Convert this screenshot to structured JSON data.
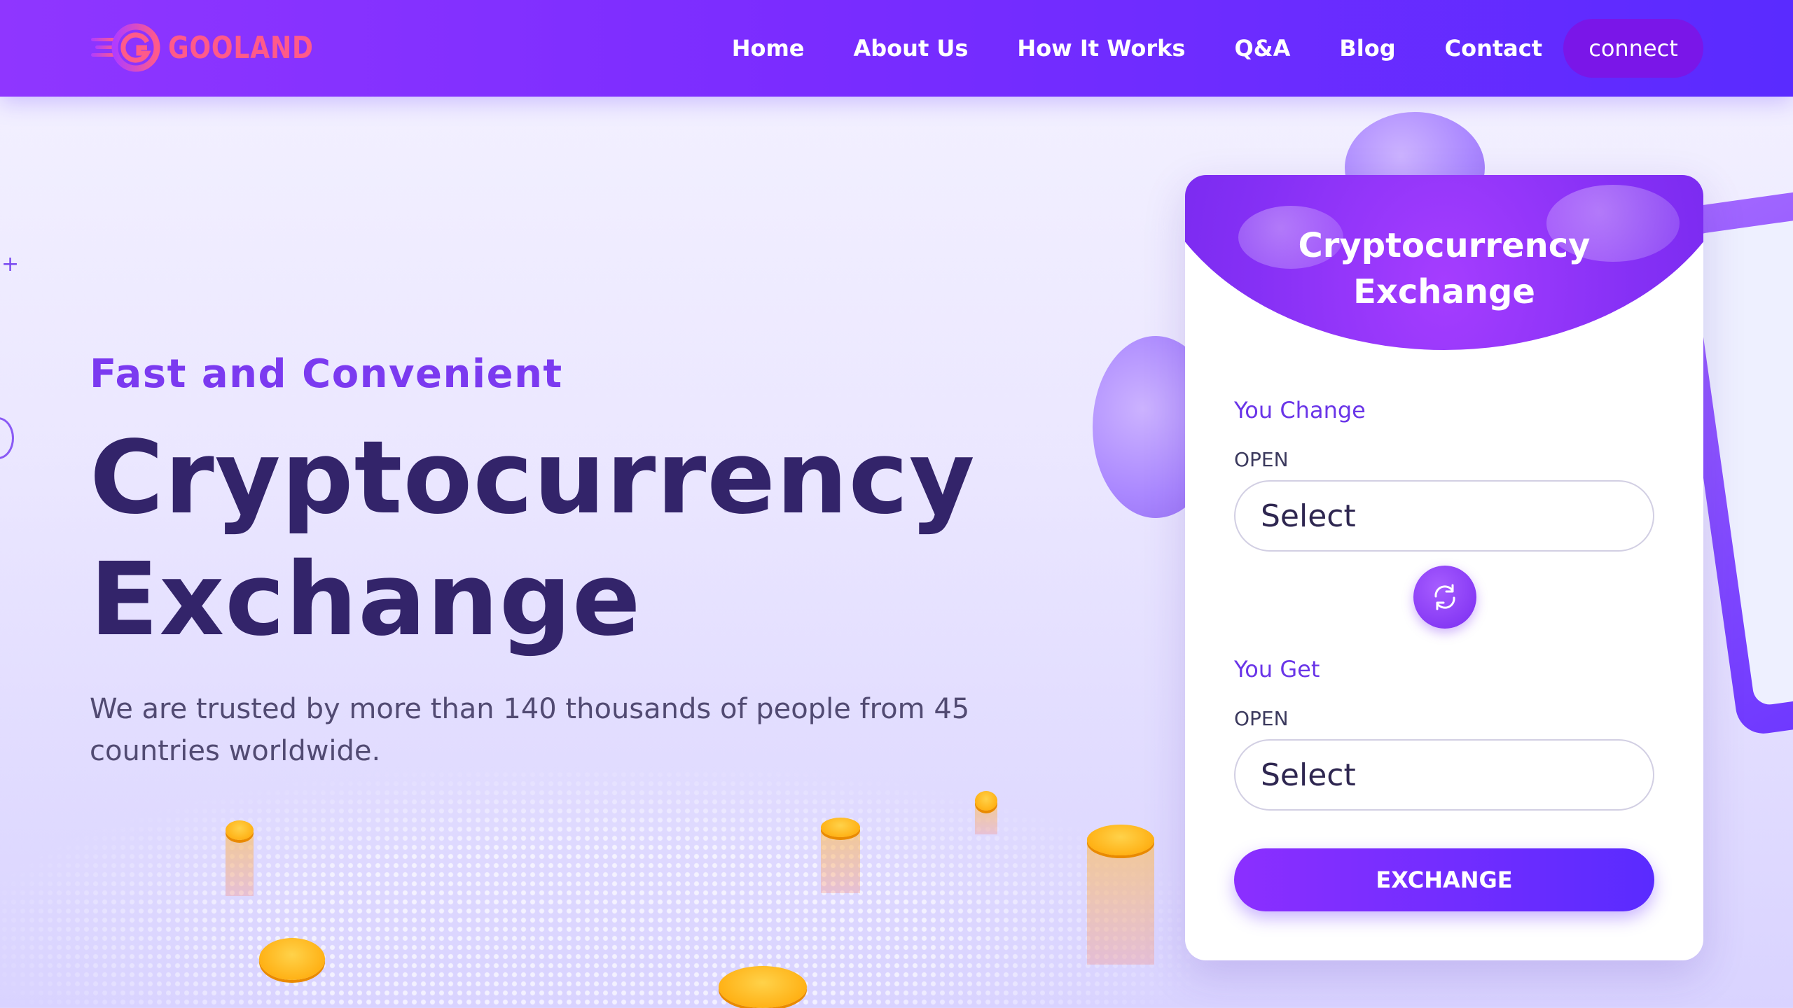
{
  "brand": {
    "name": "GOOLAND",
    "accent": "#ff5a8a"
  },
  "nav": {
    "items": [
      "Home",
      "About Us",
      "How It Works",
      "Q&A",
      "Blog",
      "Contact"
    ],
    "connect_label": "connect"
  },
  "hero": {
    "subtitle": "Fast and Convenient",
    "title_line1": "Cryptocurrency",
    "title_line2": "Exchange",
    "lead": "We are trusted by more than 140 thousands of people from 45 countries worldwide."
  },
  "exchange_card": {
    "title_line1": "Cryptocurrency",
    "title_line2": "Exchange",
    "you_change": {
      "label": "You Change",
      "sub": "OPEN",
      "select_value": "Select"
    },
    "you_get": {
      "label": "You Get",
      "sub": "OPEN",
      "select_value": "Select"
    },
    "swap_icon": "refresh-icon",
    "button_label": "EXCHANGE"
  },
  "colors": {
    "header_gradient_start": "#8f36ff",
    "header_gradient_end": "#5a2bff",
    "title_color": "#33246a",
    "subtitle_color": "#7b3af0",
    "connect_bg": "#7a16e8"
  }
}
